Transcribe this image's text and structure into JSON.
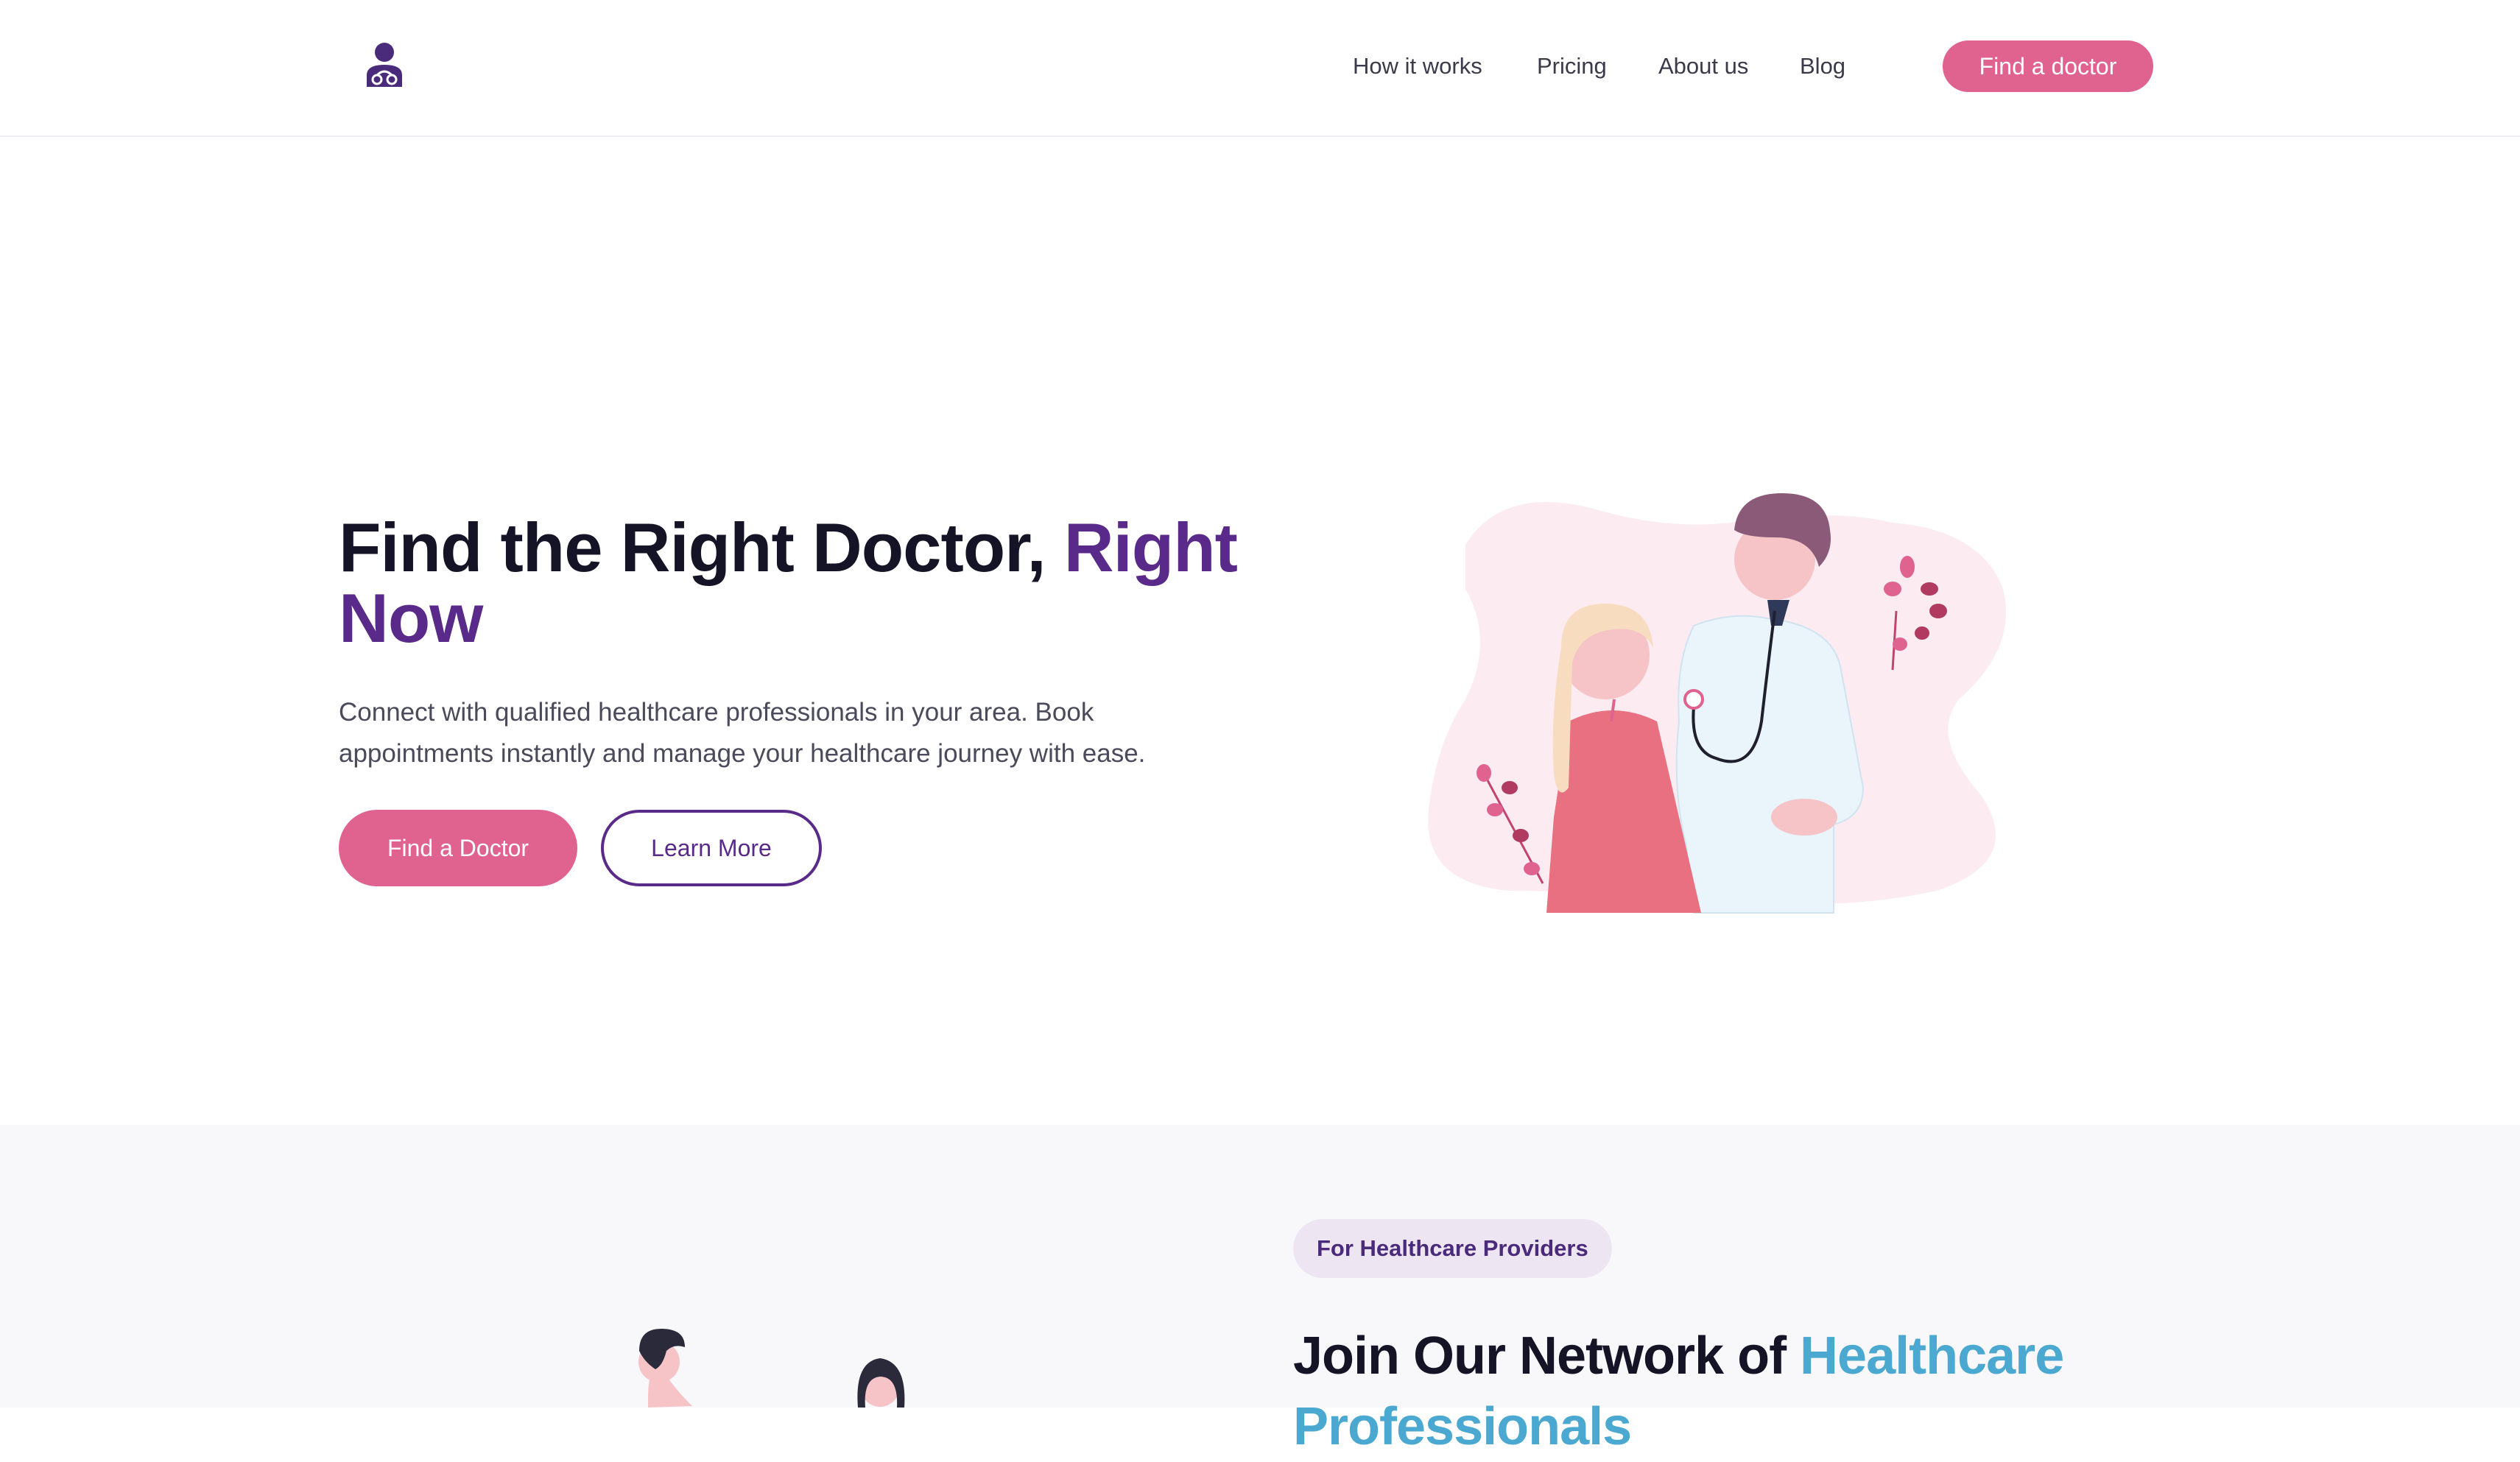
{
  "header": {
    "logo_icon": "doctor-stethoscope-icon",
    "nav": [
      {
        "label": "How it works"
      },
      {
        "label": "Pricing"
      },
      {
        "label": "About us"
      },
      {
        "label": "Blog"
      }
    ],
    "cta_label": "Find a doctor"
  },
  "hero": {
    "title_main": "Find the Right Doctor, ",
    "title_accent": "Right Now",
    "description": "Connect with qualified healthcare professionals in your area. Book appointments instantly and manage your healthcare journey with ease.",
    "primary_button": "Find a Doctor",
    "secondary_button": "Learn More",
    "illustration": "doctor-patient-illustration"
  },
  "providers": {
    "badge": "For Healthcare Providers",
    "title_main": "Join Our Network of ",
    "title_accent": "Healthcare Professionals",
    "illustration": "healthcare-team-illustration"
  },
  "colors": {
    "brand_pink": "#e0628f",
    "brand_purple": "#5a2a8a",
    "accent_blue": "#4ba8d0"
  }
}
